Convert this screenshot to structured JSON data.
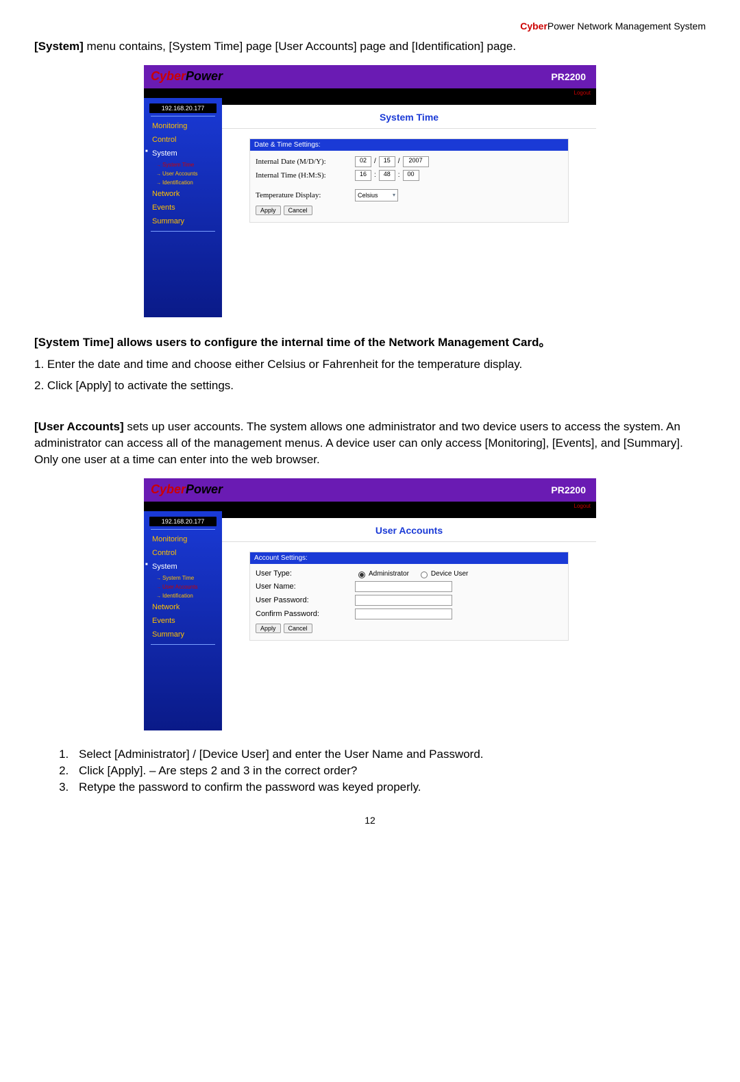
{
  "header": {
    "brand_red": "Cyber",
    "brand_rest": "Power Network Management System"
  },
  "intro": {
    "b": "[System]",
    "rest": " menu contains, [System Time] page [User Accounts] page and [Identification] page."
  },
  "shot1": {
    "logo_a": "Cyber",
    "logo_b": "Power",
    "model": "PR2200",
    "logout": "Logout",
    "ip": "192.168.20.177",
    "nav": {
      "monitoring": "Monitoring",
      "control": "Control",
      "system": "System",
      "sub_time": "System Time",
      "sub_users": "User Accounts",
      "sub_ident": "Identification",
      "network": "Network",
      "events": "Events",
      "summary": "Summary"
    },
    "title": "System Time",
    "panel_head": "Date & Time Settings:",
    "label_date": "Internal Date (M/D/Y):",
    "label_time": "Internal Time (H:M:S):",
    "label_temp": "Temperature Display:",
    "date": {
      "m": "02",
      "d": "15",
      "y": "2007"
    },
    "time": {
      "h": "16",
      "m": "48",
      "s": "00"
    },
    "temp_val": "Celsius",
    "apply": "Apply",
    "cancel": "Cancel"
  },
  "mid": {
    "b1": "[System Time] allows users to configure the internal time of the Network Management Card。",
    "l1": "1. Enter the date and time and choose either Celsius or Fahrenheit for the temperature display.",
    "l2": "2. Click [Apply] to activate the settings.",
    "b2a": "[User Accounts]",
    "b2b": " sets up user accounts. The system allows one administrator and two device users to access the system. An administrator can access all of the management menus. A device user can only access [Monitoring], [Events], and [Summary].   Only one user at a time can enter into the web browser."
  },
  "shot2": {
    "title": "User Accounts",
    "panel_head": "Account Settings:",
    "label_type": "User Type:",
    "label_name": "User Name:",
    "label_pw": "User Password:",
    "label_cpw": "Confirm Password:",
    "radio_admin": "Administrator",
    "radio_user": "Device User",
    "apply": "Apply",
    "cancel": "Cancel"
  },
  "steps": {
    "s1": "Select [Administrator] / [Device User] and enter the User Name and Password.",
    "s2": "Click [Apply]. – Are steps 2 and 3 in the correct order?",
    "s3": "Retype the password to confirm the password was keyed properly."
  },
  "pagenum": "12"
}
